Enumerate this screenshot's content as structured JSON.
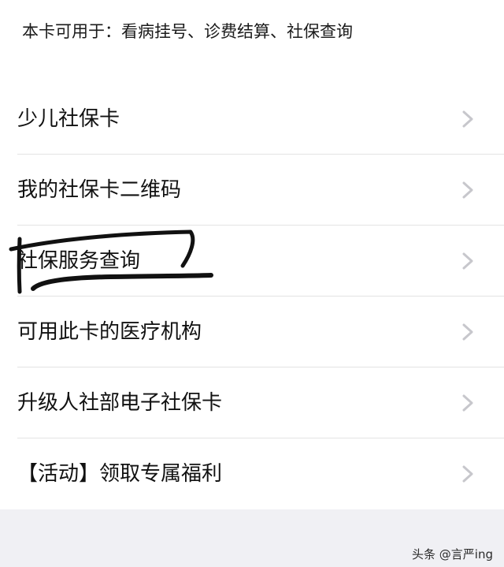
{
  "notice": {
    "text": "本卡可用于：看病挂号、诊费结算、社保查询"
  },
  "menu": {
    "items": [
      {
        "label": "少儿社保卡"
      },
      {
        "label": "我的社保卡二维码"
      },
      {
        "label": "社保服务查询"
      },
      {
        "label": "可用此卡的医疗机构"
      },
      {
        "label": "升级人社部电子社保卡"
      },
      {
        "label": "【活动】领取专属福利"
      }
    ],
    "chevron_icon": "chevron-right-icon"
  },
  "watermark": {
    "text": "头条 @言严ing"
  },
  "colors": {
    "background": "#ffffff",
    "divider": "#e3e3e3",
    "chevron": "#c7c7cc",
    "footer": "#f0f0f4",
    "annotation_ink": "#111111"
  }
}
